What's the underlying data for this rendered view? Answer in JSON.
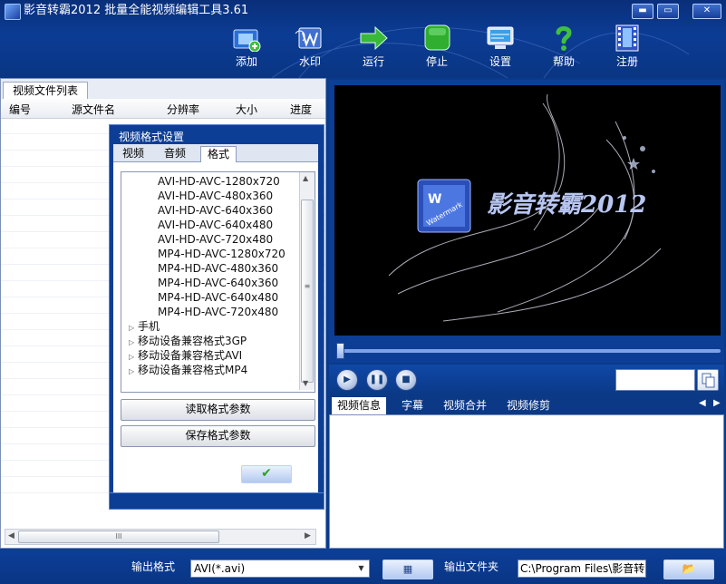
{
  "window": {
    "title": "影音转霸2012 批量全能视频编辑工具3.61",
    "controls": {
      "minimize": "▬",
      "maximize": "▭",
      "close": "✕"
    }
  },
  "toolbar": {
    "items": [
      {
        "label": "添加",
        "icon": "add-video-icon"
      },
      {
        "label": "水印",
        "icon": "watermark-icon"
      },
      {
        "label": "运行",
        "icon": "run-arrow-icon"
      },
      {
        "label": "停止",
        "icon": "stop-icon"
      },
      {
        "label": "设置",
        "icon": "settings-monitor-icon"
      },
      {
        "label": "帮助",
        "icon": "help-icon"
      },
      {
        "label": "注册",
        "icon": "register-film-icon"
      }
    ]
  },
  "file_list": {
    "tab": "视频文件列表",
    "columns": [
      "编号",
      "源文件名",
      "分辨率",
      "大小",
      "进度"
    ],
    "scroll_thumb": "III"
  },
  "format_dialog": {
    "title": "视频格式设置",
    "tabs": [
      "视频",
      "音频",
      "格式"
    ],
    "active_tab": "格式",
    "tree_items": [
      "AVI-HD-AVC-1280x720",
      "AVI-HD-AVC-480x360",
      "AVI-HD-AVC-640x360",
      "AVI-HD-AVC-640x480",
      "AVI-HD-AVC-720x480",
      "MP4-HD-AVC-1280x720",
      "MP4-HD-AVC-480x360",
      "MP4-HD-AVC-640x360",
      "MP4-HD-AVC-640x480",
      "MP4-HD-AVC-720x480"
    ],
    "tree_groups": [
      "手机",
      "移动设备兼容格式3GP",
      "移动设备兼容格式AVI",
      "移动设备兼容格式MP4"
    ],
    "read_button": "读取格式参数",
    "save_button": "保存格式参数",
    "ok_button": "✔",
    "scroll_thumb": "≡"
  },
  "preview": {
    "brand_text": "影音转霸2012",
    "logo_text": "Watermark"
  },
  "playback": {
    "progress": 0.0,
    "play": "▶",
    "pause": "❚❚",
    "stop": "■"
  },
  "info_panel": {
    "tabs": [
      "视频信息",
      "字幕",
      "视频合并",
      "视频修剪"
    ],
    "active_tab": "视频信息",
    "nav_prev": "◀",
    "nav_next": "▶"
  },
  "output": {
    "format_label": "输出格式",
    "format_value": "AVI(*.avi)",
    "folder_label": "输出文件夹",
    "folder_value": "C:\\Program Files\\影音转霸",
    "film_button": "▦",
    "folder_button": "📂"
  },
  "colors": {
    "chrome_blue": "#0b3c94",
    "accent_green": "#2ea121"
  }
}
